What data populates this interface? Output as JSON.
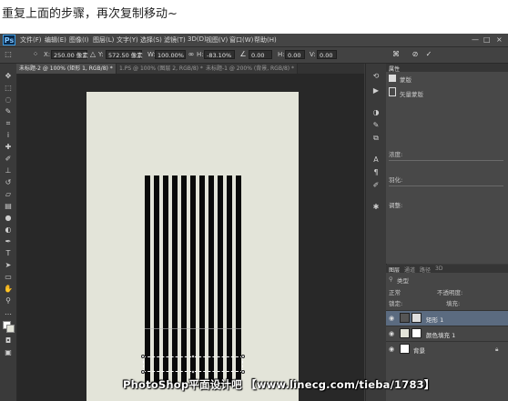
{
  "caption": "重复上面的步骤，再次复制移动~",
  "app": {
    "logo": "Ps"
  },
  "menu": [
    "文件(F)",
    "编辑(E)",
    "图像(I)",
    "图层(L)",
    "文字(Y)",
    "选择(S)",
    "滤镜(T)",
    "3D(D)",
    "视图(V)",
    "窗口(W)",
    "帮助(H)"
  ],
  "window_controls": {
    "minimize": "—",
    "maximize": "□",
    "close": "×"
  },
  "options": {
    "x_label": "X:",
    "x_value": "250.00 像素",
    "y_label": "Y:",
    "y_value": "572.50 像素",
    "w_label": "W:",
    "w_value": "100.00%",
    "h_label": "H:",
    "h_value": "-83.10%",
    "angle_value": "0.00",
    "hskew_label": "H:",
    "hskew_value": "0.00",
    "vskew_label": "V:",
    "vskew_value": "0.00",
    "cancel_icon": "⊘",
    "commit_icon": "✓"
  },
  "doc_tabs": [
    {
      "label": "未标题-2 @ 100% (矩形 1, RGB/8) *",
      "active": true
    },
    {
      "label": "1.PS @ 100% (图层 2, RGB/8) *",
      "active": false
    },
    {
      "label": "未标题-1 @ 200% (背景, RGB/8) *",
      "active": false
    }
  ],
  "properties_panel": {
    "tab": "属性",
    "title": "蒙版",
    "subtitle": "矢量蒙版",
    "density_label": "浓度:",
    "feather_label": "羽化:",
    "adjust_label": "调整:"
  },
  "layers_panel": {
    "tabs": [
      "图层",
      "通道",
      "路径",
      "3D"
    ],
    "kind_label": "类型",
    "blend_mode": "正常",
    "opacity_label": "不透明度:",
    "lock_label": "锁定:",
    "fill_label": "填充:",
    "layers": [
      {
        "name": "矩形 1",
        "selected": true
      },
      {
        "name": "颜色填充 1",
        "selected": false
      },
      {
        "name": "背景",
        "selected": false
      }
    ]
  },
  "watermark": "PhotoShop平面设计吧 【www.linecg.com/tieba/1783】",
  "colors": {
    "canvas": "#e3e4d9",
    "stripes": "#0a0a0a",
    "selected_layer": "#5b6b80"
  }
}
